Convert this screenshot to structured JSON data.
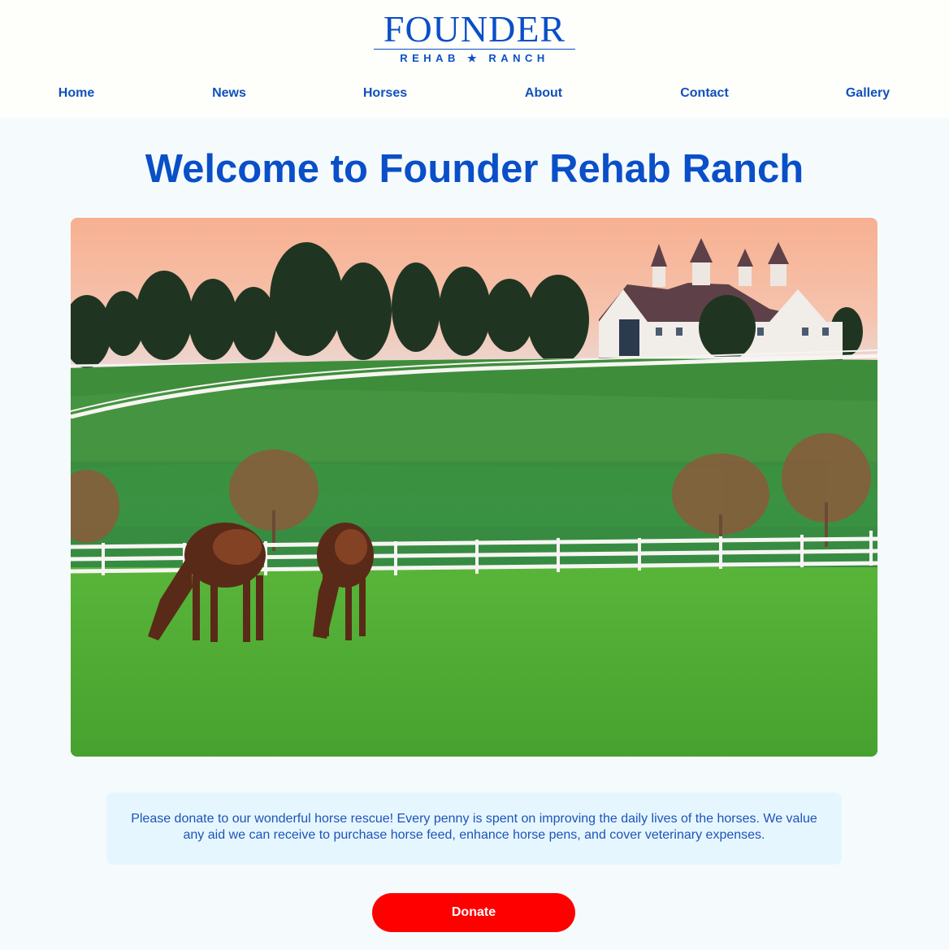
{
  "header": {
    "logo": {
      "title": "FOUNDER",
      "subtitle": "REHAB ★ RANCH"
    },
    "nav": [
      {
        "label": "Home"
      },
      {
        "label": "News"
      },
      {
        "label": "Horses"
      },
      {
        "label": "About"
      },
      {
        "label": "Contact"
      },
      {
        "label": "Gallery"
      }
    ]
  },
  "main": {
    "title": "Welcome to Founder Rehab Ranch",
    "hero_image": {
      "depicts": "horse-pasture-with-barn"
    },
    "message": "Please donate to our wonderful horse rescue! Every penny is spent on improving the daily lives of the horses. We value any aid we can receive to purchase horse feed, enhance horse pens, and cover veterinary expenses.",
    "donate_button": "Donate"
  },
  "colors": {
    "brand_blue": "#0a4fc8",
    "nav_blue": "#1150bd",
    "donate_red": "#ff0000",
    "page_bg": "#f5fbfd",
    "message_bg": "#e6f6fe"
  }
}
